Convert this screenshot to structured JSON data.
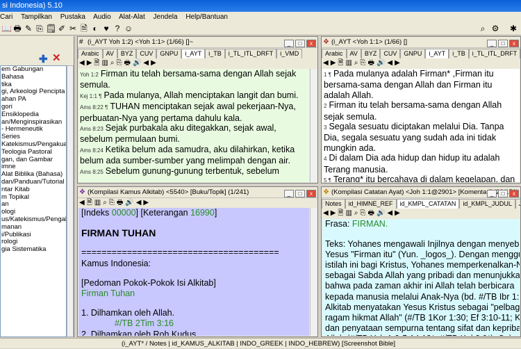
{
  "app": {
    "title": "si Indonesia) 5.10"
  },
  "menu": [
    "Cari",
    "Tampilkan",
    "Pustaka",
    "Audio",
    "Alat-Alat",
    "Jendela",
    "Help/Bantuan"
  ],
  "left_panel": {
    "items": [
      "em Gabungan",
      "Bahasa",
      "tika",
      "gi, Arkeologi Pencipta",
      "ahan PA",
      "gori",
      "",
      "Ensiklopedia",
      "an/Menginspirasikan",
      "- Hermeneutik",
      "Series",
      "Katekismus/Pengakuan",
      "Teologia Pastoral",
      "gan, dan Gambar",
      "imne",
      "",
      "Alat Biblika (Bahasa)",
      "dan/Panduan/Tutorial",
      "ntar Kitab",
      "m Topikal",
      "an",
      "",
      "ologi",
      "us/Katekismus/Pengak",
      "manan",
      "i/Publikasi",
      "",
      "rologi",
      "gia Sistematika"
    ]
  },
  "win_bible1": {
    "title": "(i_AYT Yoh 1:2) <Yoh 1:1> (1/66) []~",
    "tabs": [
      "Arabic",
      "AV",
      "BYZ",
      "CUV",
      "GNPU",
      "i_AYT",
      "i_TB",
      "i_TL_ITL_DRFT",
      "i_VMD"
    ],
    "verses": [
      {
        "ref": "Yoh 1:2",
        "text": "Firman itu telah bersama-sama dengan Allah sejak semula."
      },
      {
        "ref": "Kej 1:1 ¶",
        "text": "Pada mulanya, Allah menciptakan langit dan bumi."
      },
      {
        "ref": "Ams 8:22 ¶",
        "text": "TUHAN menciptakan sejak awal pekerjaan-Nya, perbuatan-Nya yang pertama dahulu kala."
      },
      {
        "ref": "Ams 8:23",
        "text": "Sejak purbakala aku ditegakkan, sejak awal, sebelum permulaan bumi."
      },
      {
        "ref": "Ams 8:24",
        "text": "Ketika belum ada samudra, aku dilahirkan, ketika belum ada sumber-sumber yang melimpah dengan air."
      },
      {
        "ref": "Ams 8:25",
        "text": "Sebelum gunung-gunung terbentuk, sebelum"
      }
    ]
  },
  "win_bible2": {
    "title": "(i_AYT <Yoh 1:1> (1/66) []",
    "tabs": [
      "Arabic",
      "AV",
      "BYZ",
      "CUV",
      "GNPU",
      "i_AYT",
      "i_TB",
      "i_TL_ITL_DRFT",
      "i_VM"
    ],
    "verses": [
      {
        "ref": "1 ¶",
        "text": "Pada mulanya adalah Firman* ,Firman itu bersama-sama dengan Allah dan Firman itu adalah Allah."
      },
      {
        "ref": "2",
        "text": "Firman itu telah bersama-sama dengan Allah sejak semula."
      },
      {
        "ref": "3",
        "text": "Segala sesuatu diciptakan melalui Dia. Tanpa Dia, segala sesuatu yang sudah ada ini tidak mungkin ada."
      },
      {
        "ref": "4",
        "text": "Di dalam Dia ada hidup dan hidup itu adalah Terang manusia."
      },
      {
        "ref": "5 ¶",
        "text": "Terang* itu bercahaya di dalam kegelapan, dan kegelapan tidak dapat menguasai-Nya* ."
      }
    ]
  },
  "win_dict": {
    "title": "(Kompilasi Kamus Alkitab) <5540> [Buku/Topik] (1/241)",
    "index_label": "[Indeks ",
    "index_num": "00000",
    "ket_label": "] [Keterangan ",
    "ket_num": "16990",
    "ket_end": "]",
    "heading": "FIRMAN TUHAN",
    "separator": "=======================================",
    "source": "Kamus Indonesia:",
    "section": "[Pedoman Pokok-Pokok Isi Alkitab]",
    "link_title": "Firman Tuhan",
    "item1": "1. Dilhamkan oleh Allah.",
    "item1_ref": "#/TB  2Tim 3:16",
    "item2": "2. Dilhamkan oleh Roh Kudus."
  },
  "win_notes": {
    "title": "(Kompilasi Catatan Ayat) <Joh 1:1@2901> [Komentari] (23/179)",
    "tabs": [
      "Notes",
      "id_HIMNE_REF",
      "id_KMPL_CATATAN",
      "id_KMPL_JUDUL",
      "JFB"
    ],
    "frasa_label": "Frasa: ",
    "frasa_value": "FIRMAN.",
    "lines": [
      "Teks:  Yohanes mengawali Injilnya dengan menyebut",
      "Yesus \"Firman itu\" (Yun. _logos_). Dengan menggunakan",
      "istilah ini bagi Kristus, Yohanes memperkenalkan-Nya",
      "sebagai Sabda Allah yang pribadi dan menunjukkan",
      "bahwa pada zaman akhir ini Allah telah berbicara",
      "kepada manusia melalui Anak-Nya (bd. #/TB Ibr 1:1",
      "Alkitab menyatakan Yesus Kristus sebagai \"pelbagai",
      "ragam hikmat Allah\" (#/TB 1Kor 1:30; Ef 3:10-11; Ko",
      "dan penyataan sempurna tentang sifat dan kepribadian",
      "Allah (#/TB Yoh 1:3-5,14,18*; #/TB Kol 2:9*). Sebagai"
    ]
  },
  "statusbar": {
    "text": "(i_AYT* / Notes | id_KAMUS_ALKITAB | INDO_GREEK | INDO_HEBREW)     [Screenshot Bible]"
  }
}
